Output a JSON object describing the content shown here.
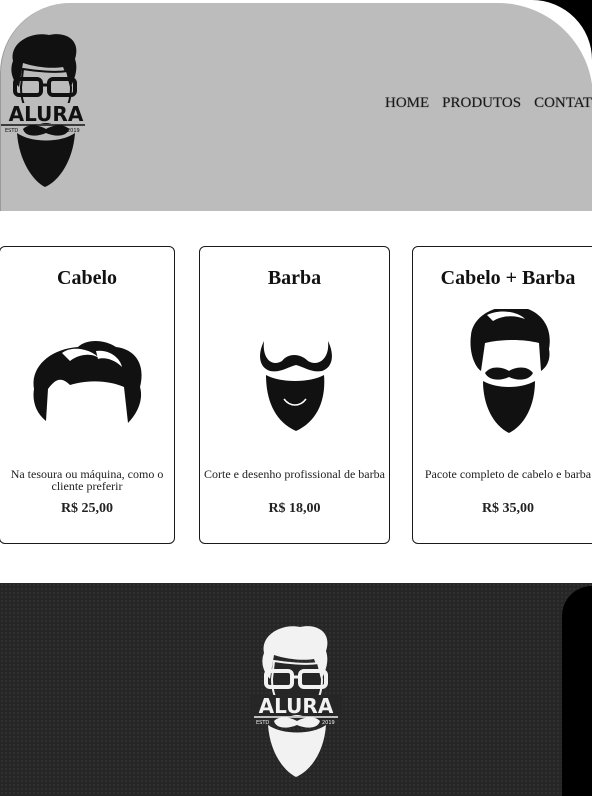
{
  "brand": {
    "logo_text": "ALURA",
    "logo_est": "ESTD",
    "logo_year": "2019"
  },
  "nav": {
    "items": [
      "HOME",
      "PRODUTOS",
      "CONTATO"
    ]
  },
  "cards": [
    {
      "title": "Cabelo",
      "description": "Na tesoura ou máquina, como o cliente preferir",
      "price": "R$ 25,00",
      "icon": "hair-icon"
    },
    {
      "title": "Barba",
      "description": "Corte e desenho profissional de barba",
      "price": "R$ 18,00",
      "icon": "beard-icon"
    },
    {
      "title": "Cabelo + Barba",
      "description": "Pacote completo de cabelo e barba",
      "price": "R$ 35,00",
      "icon": "hair-beard-icon"
    }
  ],
  "colors": {
    "header_bg": "#bcbcbc",
    "footer_bg": "#262626",
    "text": "#111111"
  }
}
